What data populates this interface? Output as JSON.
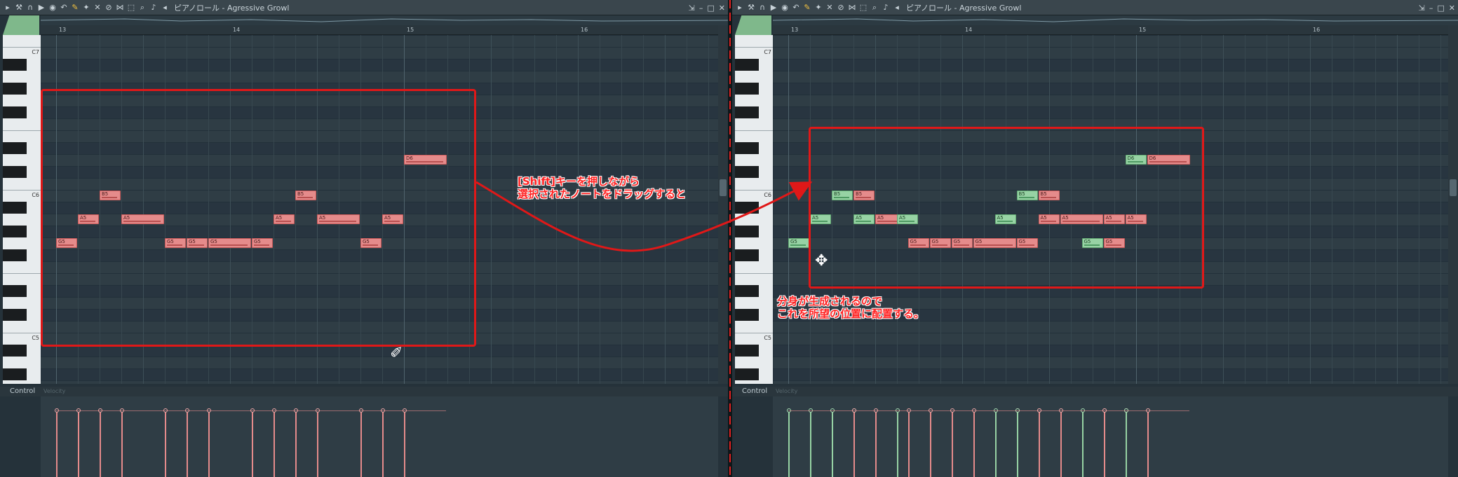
{
  "left_panel": {
    "title": "ピアノロール - Agressive Growl",
    "bar_labels": [
      "13",
      "14",
      "15",
      "16"
    ],
    "octave_labels": [
      "C7",
      "C6",
      "C5"
    ],
    "control_label": "Control",
    "control_sublabel": "Velocity",
    "notes": [
      {
        "label": "G5"
      },
      {
        "label": "A5"
      },
      {
        "label": "B5"
      },
      {
        "label": "A5"
      },
      {
        "label": "G5"
      },
      {
        "label": "G5"
      },
      {
        "label": "G5"
      },
      {
        "label": "G5"
      },
      {
        "label": "A5"
      },
      {
        "label": "B5"
      },
      {
        "label": "A5"
      },
      {
        "label": "G5"
      },
      {
        "label": "A5"
      },
      {
        "label": "D6"
      }
    ]
  },
  "right_panel": {
    "title": "ピアノロール - Agressive Growl",
    "bar_labels": [
      "13",
      "14",
      "15",
      "16"
    ],
    "octave_labels": [
      "C7",
      "C6",
      "C5"
    ],
    "control_label": "Control",
    "control_sublabel": "Velocity",
    "notes": [
      {
        "label": "G5"
      },
      {
        "label": "A5"
      },
      {
        "label": "B5"
      },
      {
        "label": "A5"
      },
      {
        "label": "A5"
      },
      {
        "label": "B5"
      },
      {
        "label": "A5"
      },
      {
        "label": "G5"
      },
      {
        "label": "G5"
      },
      {
        "label": "G5"
      },
      {
        "label": "G5"
      },
      {
        "label": "G5"
      },
      {
        "label": "A5"
      },
      {
        "label": "A5"
      },
      {
        "label": "A5"
      },
      {
        "label": "A5"
      },
      {
        "label": "B5"
      },
      {
        "label": "B5"
      },
      {
        "label": "G5"
      },
      {
        "label": "G5"
      },
      {
        "label": "A5"
      },
      {
        "label": "D6"
      },
      {
        "label": "D6"
      }
    ]
  },
  "annotations": {
    "instruction_line1": "[Shift]キーを押しながら",
    "instruction_line2": "選択されたノートをドラッグすると",
    "result_line1": "分身が生成されるので",
    "result_line2": "これを所望の位置に配置する。"
  },
  "colors": {
    "selected_note": "#e58b8b",
    "copied_note": "#97d3a4",
    "annotation": "#e01818"
  }
}
